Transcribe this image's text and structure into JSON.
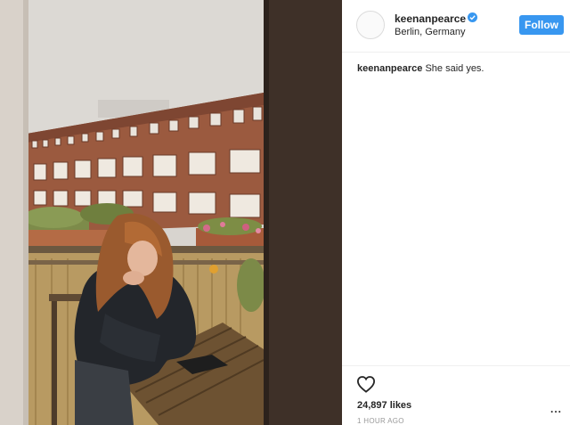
{
  "post": {
    "author": {
      "username": "keenanpearce",
      "verified": true,
      "location": "Berlin, Germany"
    },
    "follow_label": "Follow",
    "caption": {
      "username": "keenanpearce",
      "text": "She said yes."
    },
    "likes_text": "24,897 likes",
    "timestamp": "1 HOUR AGO",
    "more_label": "...",
    "icons": {
      "verified": "verified-badge-icon",
      "like": "heart-outline-icon",
      "more": "more-options-icon"
    },
    "colors": {
      "follow_button": "#3897f0",
      "verified_badge": "#3897f0",
      "text": "#262626",
      "muted": "#999999"
    }
  }
}
